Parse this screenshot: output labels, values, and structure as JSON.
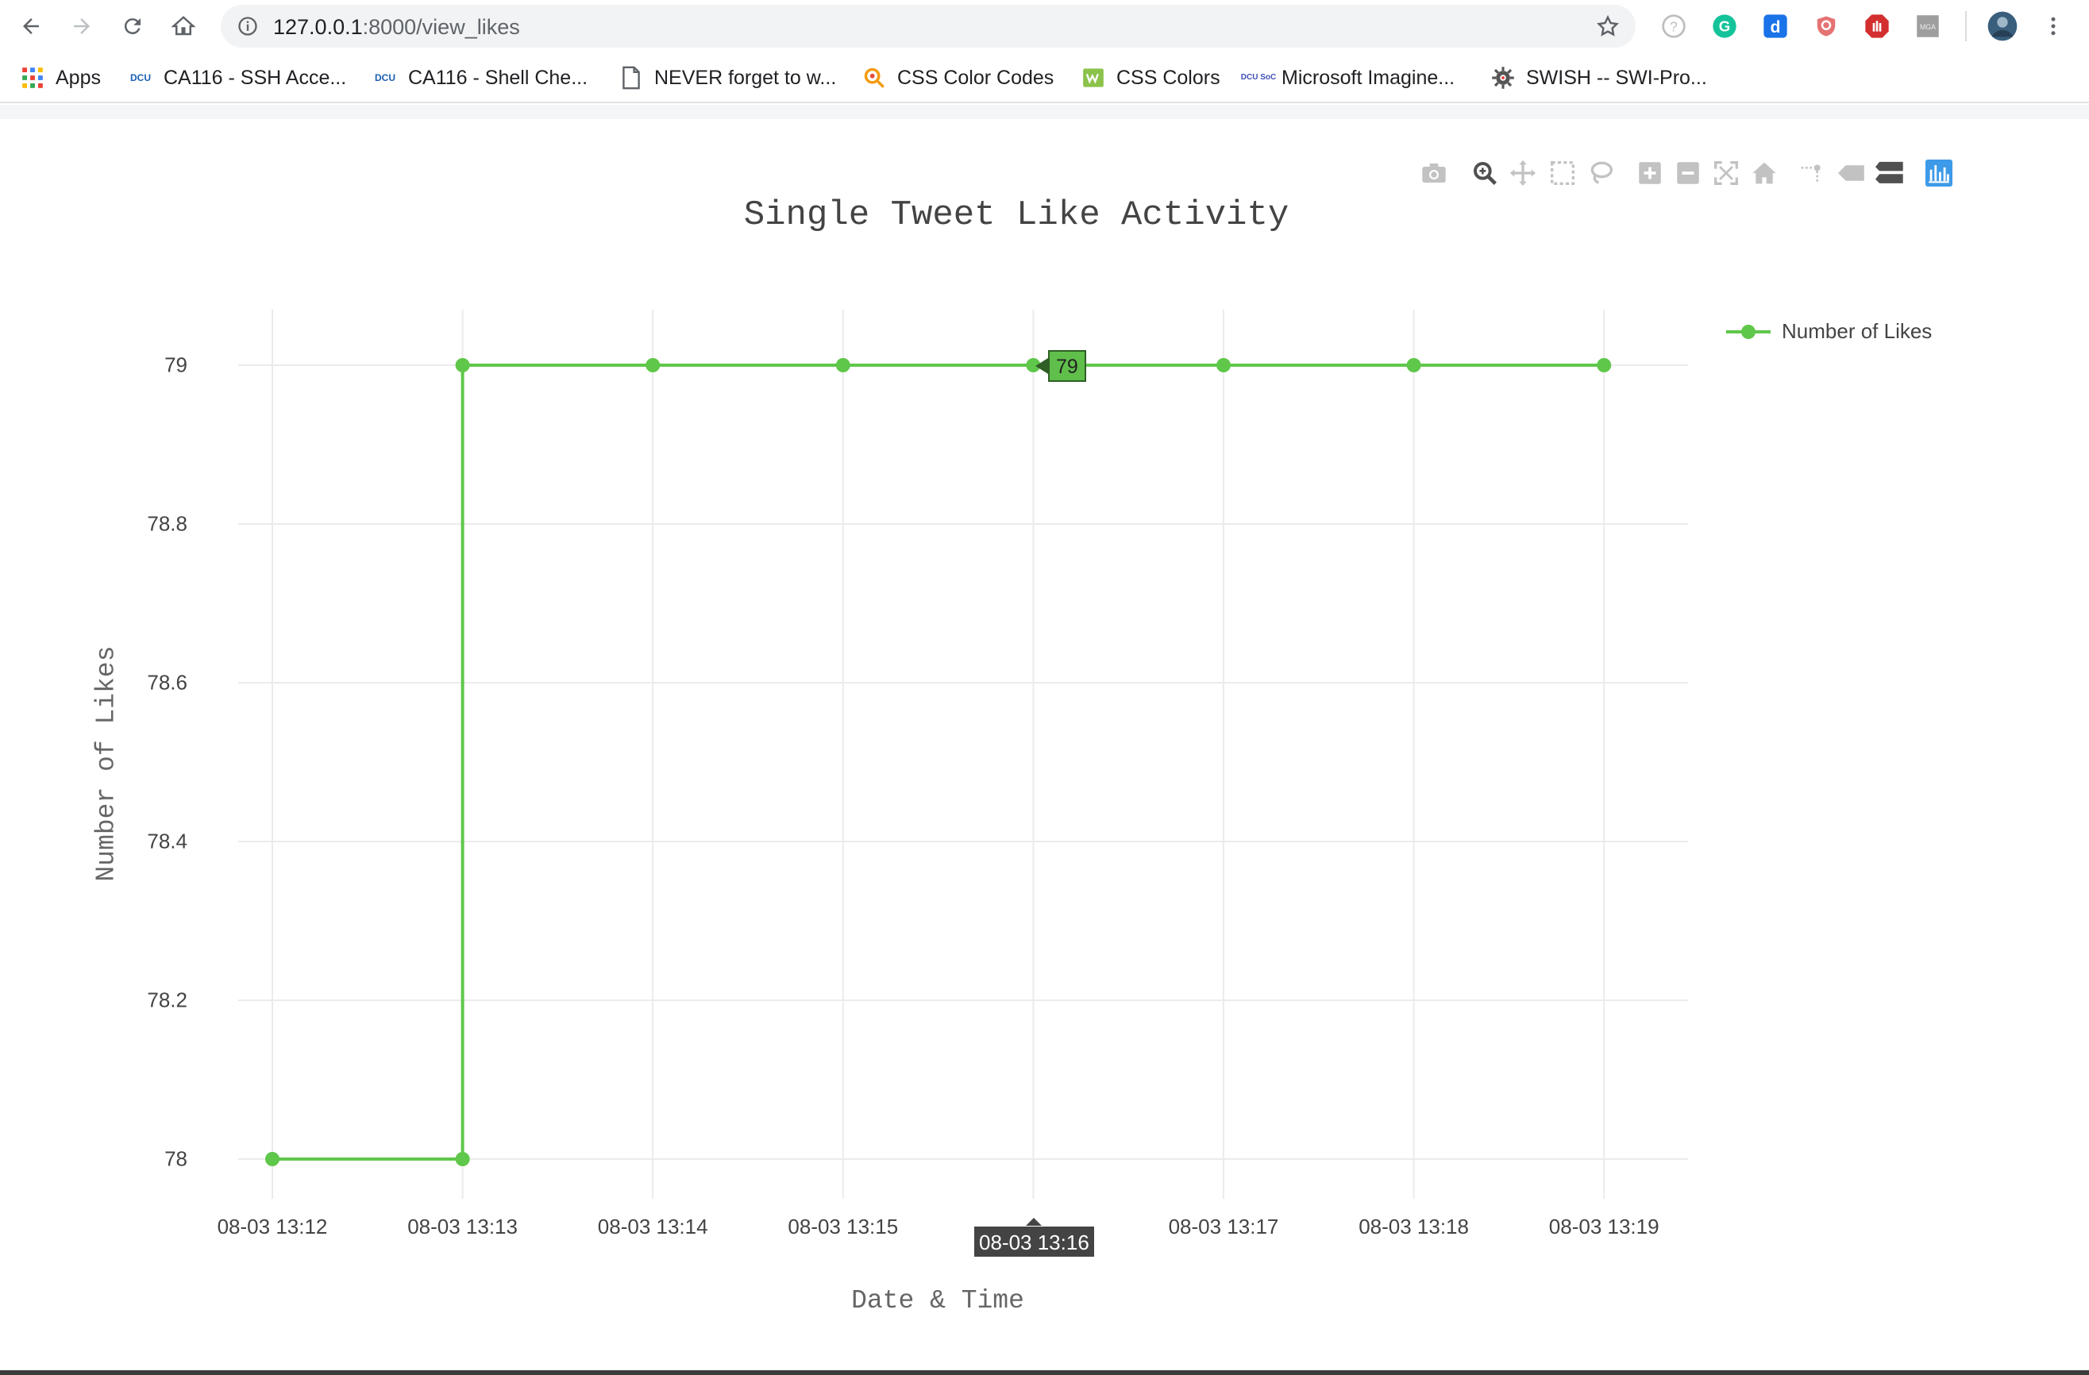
{
  "browser": {
    "url_host": "127.0.0.1",
    "url_rest": ":8000/view_likes"
  },
  "bookmarks": [
    {
      "label": "Apps",
      "icon": "apps-grid-icon"
    },
    {
      "label": "CA116 - SSH Acce...",
      "icon": "dcu-icon",
      "favtext": "DCU"
    },
    {
      "label": "CA116 - Shell Che...",
      "icon": "dcu-icon",
      "favtext": "DCU"
    },
    {
      "label": "NEVER forget to w...",
      "icon": "document-icon"
    },
    {
      "label": "CSS Color Codes",
      "icon": "color-codes-icon"
    },
    {
      "label": "CSS Colors",
      "icon": "css-colors-icon"
    },
    {
      "label": "Microsoft Imagine...",
      "icon": "dcu-soc-icon",
      "favtext": "DCU SoC"
    },
    {
      "label": "SWISH -- SWI-Pro...",
      "icon": "swish-gear-icon"
    }
  ],
  "chart_data": {
    "type": "line",
    "title": "Single Tweet Like Activity",
    "xlabel": "Date & Time",
    "ylabel": "Number of Likes",
    "categories": [
      "08-03 13:12",
      "08-03 13:13",
      "08-03 13:14",
      "08-03 13:15",
      "08-03 13:16",
      "08-03 13:17",
      "08-03 13:18",
      "08-03 13:19"
    ],
    "x_tick_labels": [
      "08-03 13:12",
      "08-03 13:13",
      "08-03 13:14",
      "08-03 13:15",
      "",
      "08-03 13:17",
      "08-03 13:18",
      "08-03 13:19"
    ],
    "x_values": [
      0,
      0.5,
      1,
      2,
      3,
      4,
      5,
      6,
      7
    ],
    "series": [
      {
        "name": "Number of Likes",
        "x_index": [
          0,
          1,
          1,
          2,
          3,
          4,
          5,
          6,
          7
        ],
        "values": [
          78,
          78,
          79,
          79,
          79,
          79,
          79,
          79,
          79
        ],
        "color": "#5fc74a"
      }
    ],
    "y_ticks": [
      "78",
      "78.2",
      "78.4",
      "78.6",
      "78.8",
      "79"
    ],
    "ylim": [
      77.94,
      79.07
    ],
    "grid": true,
    "legend_position": "top-right",
    "hover": {
      "x_label": "08-03 13:16",
      "y_label": "79"
    }
  }
}
